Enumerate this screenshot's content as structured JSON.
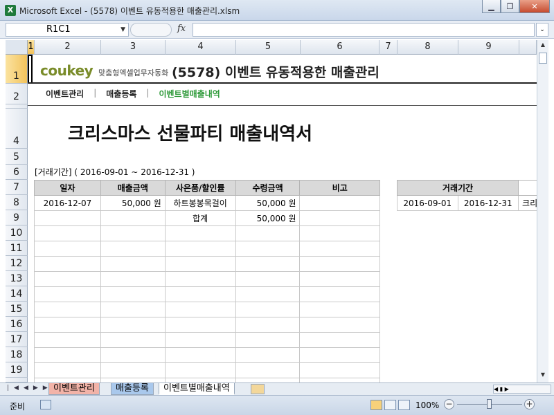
{
  "window": {
    "app_icon": "excel-icon",
    "title": "Microsoft Excel - (5578) 이벤트 유동적용한 매출관리.xlsm",
    "buttons": [
      "minimize",
      "restore",
      "close"
    ]
  },
  "formula_bar": {
    "name_box": "R1C1",
    "fx_label": "fx",
    "formula": ""
  },
  "columns": [
    "1",
    "2",
    "3",
    "4",
    "5",
    "6",
    "7",
    "8",
    "9"
  ],
  "rows": [
    "1",
    "2",
    "3",
    "4",
    "5",
    "6",
    "7",
    "8",
    "9",
    "10",
    "11",
    "12",
    "13",
    "14",
    "15",
    "16",
    "17",
    "18",
    "19"
  ],
  "content": {
    "logo": "coukey",
    "logo_tagline": "맞춤형엑셀업무자동화",
    "doc_title": "(5578) 이벤트 유동적용한 매출관리",
    "nav": [
      {
        "label": "이벤트관리",
        "active": false
      },
      {
        "label": "매출등록",
        "active": false
      },
      {
        "label": "이벤트별매출내역",
        "active": true
      }
    ],
    "nav_separator": "|",
    "report_title": "크리스마스 선물파티 매출내역서",
    "period_label": "[거래기간] ( 2016-09-01 ~ 2016-12-31 )",
    "table": {
      "headers": [
        "일자",
        "매출금액",
        "사은품/할인률",
        "수령금액",
        "비고"
      ],
      "rows": [
        [
          "2016-12-07",
          "50,000 원",
          "하트봉봉목걸이",
          "50,000 원",
          ""
        ]
      ],
      "total": [
        "",
        "",
        "합계",
        "50,000 원",
        ""
      ]
    },
    "side_table": {
      "header": "거래기간",
      "start": "2016-09-01",
      "end": "2016-12-31",
      "extra": "크리"
    }
  },
  "sheet_tabs": [
    {
      "label": "이벤트관리",
      "color": "#f2b3a8",
      "active": false
    },
    {
      "label": "매출등록",
      "color": "#a9c8ec",
      "active": false
    },
    {
      "label": "이벤트별매출내역",
      "color": "#ffffff",
      "active": true
    }
  ],
  "status": {
    "ready": "준비",
    "zoom": "100%"
  }
}
